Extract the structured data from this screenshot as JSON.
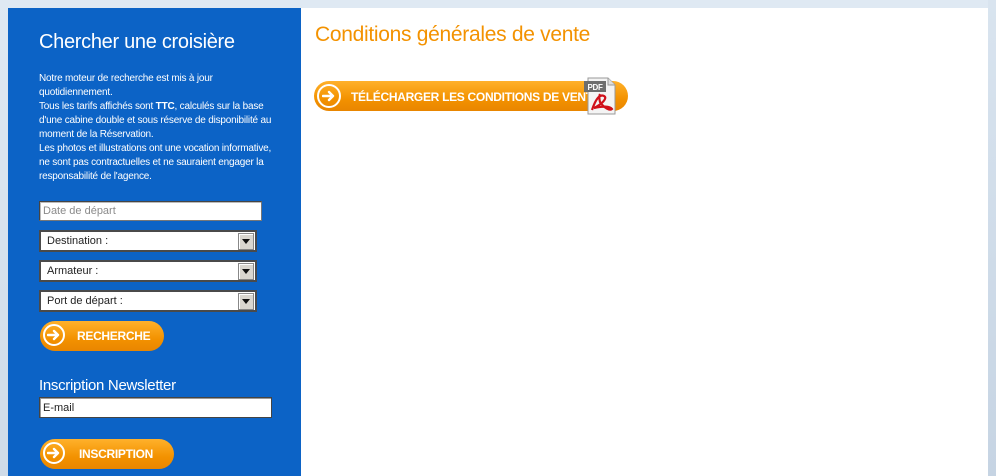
{
  "sidebar": {
    "title": "Chercher une croisière",
    "note_line1": "Notre moteur de recherche est mis à jour quotidiennement.",
    "note_line2_pre": "Tous les tarifs affichés sont ",
    "note_line2_bold": "TTC",
    "note_line2_post": ", calculés sur la base d'une cabine double et sous réserve de disponibilité au moment de la Réservation.",
    "note_line3": "Les photos et illustrations ont une vocation informative, ne sont pas contractuelles et ne sauraient engager la responsabilité de l'agence.",
    "date_placeholder": "Date de départ",
    "selects": {
      "destination": "Destination :",
      "armateur": "Armateur :",
      "port": "Port de départ :"
    },
    "search_button": "RECHERCHE",
    "newsletter_title": "Inscription Newsletter",
    "email_value": "E-mail",
    "subscribe_button": "INSCRIPTION"
  },
  "main": {
    "title": "Conditions générales de vente",
    "download_button": "TÉLÉCHARGER LES CONDITIONS DE VENTE",
    "pdf_label": "PDF"
  },
  "colors": {
    "sidebar_blue": "#0c63c6",
    "accent_orange": "#f39200"
  },
  "icons": {
    "arrow": "arrow-right-circle-icon",
    "pdf": "pdf-file-icon"
  }
}
